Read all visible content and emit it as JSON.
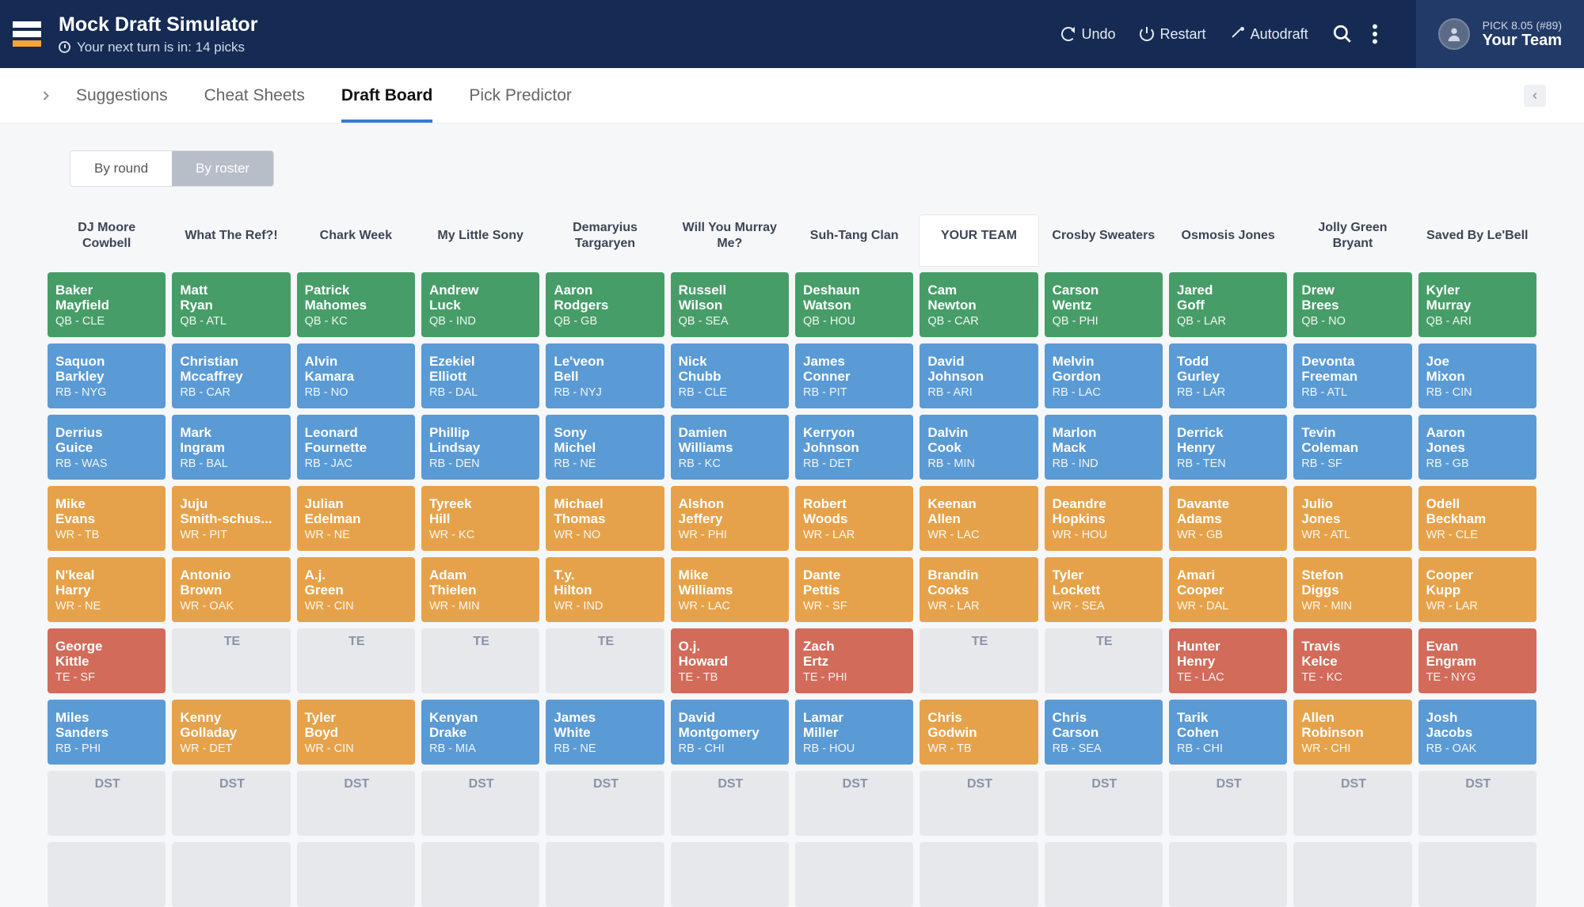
{
  "header": {
    "title": "Mock Draft Simulator",
    "subtitle": "Your next turn is in: 14 picks",
    "undo": "Undo",
    "restart": "Restart",
    "autodraft": "Autodraft",
    "pick_label": "PICK 8.05 (#89)",
    "team_name": "Your Team"
  },
  "tabs": {
    "items": [
      "Suggestions",
      "Cheat Sheets",
      "Draft Board",
      "Pick Predictor"
    ],
    "active": 2
  },
  "toggle": {
    "by_round": "By round",
    "by_roster": "By roster"
  },
  "teams": [
    "DJ Moore Cowbell",
    "What The Ref?!",
    "Chark Week",
    "My Little Sony",
    "Demaryius Targaryen",
    "Will You Murray Me?",
    "Suh-Tang Clan",
    "YOUR TEAM",
    "Crosby Sweaters",
    "Osmosis Jones",
    "Jolly Green Bryant",
    "Saved By Le'Bell"
  ],
  "your_team_index": 7,
  "rows": [
    [
      {
        "first": "Baker",
        "last": "Mayfield",
        "pos": "QB",
        "team": "CLE"
      },
      {
        "first": "Matt",
        "last": "Ryan",
        "pos": "QB",
        "team": "ATL"
      },
      {
        "first": "Patrick",
        "last": "Mahomes",
        "pos": "QB",
        "team": "KC"
      },
      {
        "first": "Andrew",
        "last": "Luck",
        "pos": "QB",
        "team": "IND"
      },
      {
        "first": "Aaron",
        "last": "Rodgers",
        "pos": "QB",
        "team": "GB"
      },
      {
        "first": "Russell",
        "last": "Wilson",
        "pos": "QB",
        "team": "SEA"
      },
      {
        "first": "Deshaun",
        "last": "Watson",
        "pos": "QB",
        "team": "HOU"
      },
      {
        "first": "Cam",
        "last": "Newton",
        "pos": "QB",
        "team": "CAR"
      },
      {
        "first": "Carson",
        "last": "Wentz",
        "pos": "QB",
        "team": "PHI"
      },
      {
        "first": "Jared",
        "last": "Goff",
        "pos": "QB",
        "team": "LAR"
      },
      {
        "first": "Drew",
        "last": "Brees",
        "pos": "QB",
        "team": "NO"
      },
      {
        "first": "Kyler",
        "last": "Murray",
        "pos": "QB",
        "team": "ARI"
      }
    ],
    [
      {
        "first": "Saquon",
        "last": "Barkley",
        "pos": "RB",
        "team": "NYG"
      },
      {
        "first": "Christian",
        "last": "Mccaffrey",
        "pos": "RB",
        "team": "CAR"
      },
      {
        "first": "Alvin",
        "last": "Kamara",
        "pos": "RB",
        "team": "NO"
      },
      {
        "first": "Ezekiel",
        "last": "Elliott",
        "pos": "RB",
        "team": "DAL"
      },
      {
        "first": "Le'veon",
        "last": "Bell",
        "pos": "RB",
        "team": "NYJ"
      },
      {
        "first": "Nick",
        "last": "Chubb",
        "pos": "RB",
        "team": "CLE"
      },
      {
        "first": "James",
        "last": "Conner",
        "pos": "RB",
        "team": "PIT"
      },
      {
        "first": "David",
        "last": "Johnson",
        "pos": "RB",
        "team": "ARI"
      },
      {
        "first": "Melvin",
        "last": "Gordon",
        "pos": "RB",
        "team": "LAC"
      },
      {
        "first": "Todd",
        "last": "Gurley",
        "pos": "RB",
        "team": "LAR"
      },
      {
        "first": "Devonta",
        "last": "Freeman",
        "pos": "RB",
        "team": "ATL"
      },
      {
        "first": "Joe",
        "last": "Mixon",
        "pos": "RB",
        "team": "CIN"
      }
    ],
    [
      {
        "first": "Derrius",
        "last": "Guice",
        "pos": "RB",
        "team": "WAS"
      },
      {
        "first": "Mark",
        "last": "Ingram",
        "pos": "RB",
        "team": "BAL"
      },
      {
        "first": "Leonard",
        "last": "Fournette",
        "pos": "RB",
        "team": "JAC"
      },
      {
        "first": "Phillip",
        "last": "Lindsay",
        "pos": "RB",
        "team": "DEN"
      },
      {
        "first": "Sony",
        "last": "Michel",
        "pos": "RB",
        "team": "NE"
      },
      {
        "first": "Damien",
        "last": "Williams",
        "pos": "RB",
        "team": "KC"
      },
      {
        "first": "Kerryon",
        "last": "Johnson",
        "pos": "RB",
        "team": "DET"
      },
      {
        "first": "Dalvin",
        "last": "Cook",
        "pos": "RB",
        "team": "MIN"
      },
      {
        "first": "Marlon",
        "last": "Mack",
        "pos": "RB",
        "team": "IND"
      },
      {
        "first": "Derrick",
        "last": "Henry",
        "pos": "RB",
        "team": "TEN"
      },
      {
        "first": "Tevin",
        "last": "Coleman",
        "pos": "RB",
        "team": "SF"
      },
      {
        "first": "Aaron",
        "last": "Jones",
        "pos": "RB",
        "team": "GB"
      }
    ],
    [
      {
        "first": "Mike",
        "last": "Evans",
        "pos": "WR",
        "team": "TB"
      },
      {
        "first": "Juju",
        "last": "Smith-schus...",
        "pos": "WR",
        "team": "PIT"
      },
      {
        "first": "Julian",
        "last": "Edelman",
        "pos": "WR",
        "team": "NE"
      },
      {
        "first": "Tyreek",
        "last": "Hill",
        "pos": "WR",
        "team": "KC"
      },
      {
        "first": "Michael",
        "last": "Thomas",
        "pos": "WR",
        "team": "NO"
      },
      {
        "first": "Alshon",
        "last": "Jeffery",
        "pos": "WR",
        "team": "PHI"
      },
      {
        "first": "Robert",
        "last": "Woods",
        "pos": "WR",
        "team": "LAR"
      },
      {
        "first": "Keenan",
        "last": "Allen",
        "pos": "WR",
        "team": "LAC"
      },
      {
        "first": "Deandre",
        "last": "Hopkins",
        "pos": "WR",
        "team": "HOU"
      },
      {
        "first": "Davante",
        "last": "Adams",
        "pos": "WR",
        "team": "GB"
      },
      {
        "first": "Julio",
        "last": "Jones",
        "pos": "WR",
        "team": "ATL"
      },
      {
        "first": "Odell",
        "last": "Beckham",
        "pos": "WR",
        "team": "CLE"
      }
    ],
    [
      {
        "first": "N'keal",
        "last": "Harry",
        "pos": "WR",
        "team": "NE"
      },
      {
        "first": "Antonio",
        "last": "Brown",
        "pos": "WR",
        "team": "OAK"
      },
      {
        "first": "A.j.",
        "last": "Green",
        "pos": "WR",
        "team": "CIN"
      },
      {
        "first": "Adam",
        "last": "Thielen",
        "pos": "WR",
        "team": "MIN"
      },
      {
        "first": "T.y.",
        "last": "Hilton",
        "pos": "WR",
        "team": "IND"
      },
      {
        "first": "Mike",
        "last": "Williams",
        "pos": "WR",
        "team": "LAC"
      },
      {
        "first": "Dante",
        "last": "Pettis",
        "pos": "WR",
        "team": "SF"
      },
      {
        "first": "Brandin",
        "last": "Cooks",
        "pos": "WR",
        "team": "LAR"
      },
      {
        "first": "Tyler",
        "last": "Lockett",
        "pos": "WR",
        "team": "SEA"
      },
      {
        "first": "Amari",
        "last": "Cooper",
        "pos": "WR",
        "team": "DAL"
      },
      {
        "first": "Stefon",
        "last": "Diggs",
        "pos": "WR",
        "team": "MIN"
      },
      {
        "first": "Cooper",
        "last": "Kupp",
        "pos": "WR",
        "team": "LAR"
      }
    ],
    [
      {
        "first": "George",
        "last": "Kittle",
        "pos": "TE",
        "team": "SF"
      },
      {
        "empty": "TE"
      },
      {
        "empty": "TE"
      },
      {
        "empty": "TE"
      },
      {
        "empty": "TE"
      },
      {
        "first": "O.j.",
        "last": "Howard",
        "pos": "TE",
        "team": "TB"
      },
      {
        "first": "Zach",
        "last": "Ertz",
        "pos": "TE",
        "team": "PHI"
      },
      {
        "empty": "TE"
      },
      {
        "empty": "TE"
      },
      {
        "first": "Hunter",
        "last": "Henry",
        "pos": "TE",
        "team": "LAC"
      },
      {
        "first": "Travis",
        "last": "Kelce",
        "pos": "TE",
        "team": "KC"
      },
      {
        "first": "Evan",
        "last": "Engram",
        "pos": "TE",
        "team": "NYG"
      }
    ],
    [
      {
        "first": "Miles",
        "last": "Sanders",
        "pos": "RB",
        "team": "PHI"
      },
      {
        "first": "Kenny",
        "last": "Golladay",
        "pos": "WR",
        "team": "DET"
      },
      {
        "first": "Tyler",
        "last": "Boyd",
        "pos": "WR",
        "team": "CIN"
      },
      {
        "first": "Kenyan",
        "last": "Drake",
        "pos": "RB",
        "team": "MIA"
      },
      {
        "first": "James",
        "last": "White",
        "pos": "RB",
        "team": "NE"
      },
      {
        "first": "David",
        "last": "Montgomery",
        "pos": "RB",
        "team": "CHI"
      },
      {
        "first": "Lamar",
        "last": "Miller",
        "pos": "RB",
        "team": "HOU"
      },
      {
        "first": "Chris",
        "last": "Godwin",
        "pos": "WR",
        "team": "TB"
      },
      {
        "first": "Chris",
        "last": "Carson",
        "pos": "RB",
        "team": "SEA"
      },
      {
        "first": "Tarik",
        "last": "Cohen",
        "pos": "RB",
        "team": "CHI"
      },
      {
        "first": "Allen",
        "last": "Robinson",
        "pos": "WR",
        "team": "CHI"
      },
      {
        "first": "Josh",
        "last": "Jacobs",
        "pos": "RB",
        "team": "OAK"
      }
    ],
    [
      {
        "empty": "DST"
      },
      {
        "empty": "DST"
      },
      {
        "empty": "DST"
      },
      {
        "empty": "DST"
      },
      {
        "empty": "DST"
      },
      {
        "empty": "DST"
      },
      {
        "empty": "DST"
      },
      {
        "empty": "DST"
      },
      {
        "empty": "DST"
      },
      {
        "empty": "DST"
      },
      {
        "empty": "DST"
      },
      {
        "empty": "DST"
      }
    ],
    [
      {
        "empty": ""
      },
      {
        "empty": ""
      },
      {
        "empty": ""
      },
      {
        "empty": ""
      },
      {
        "empty": ""
      },
      {
        "empty": ""
      },
      {
        "empty": ""
      },
      {
        "empty": ""
      },
      {
        "empty": ""
      },
      {
        "empty": ""
      },
      {
        "empty": ""
      },
      {
        "empty": ""
      }
    ]
  ]
}
